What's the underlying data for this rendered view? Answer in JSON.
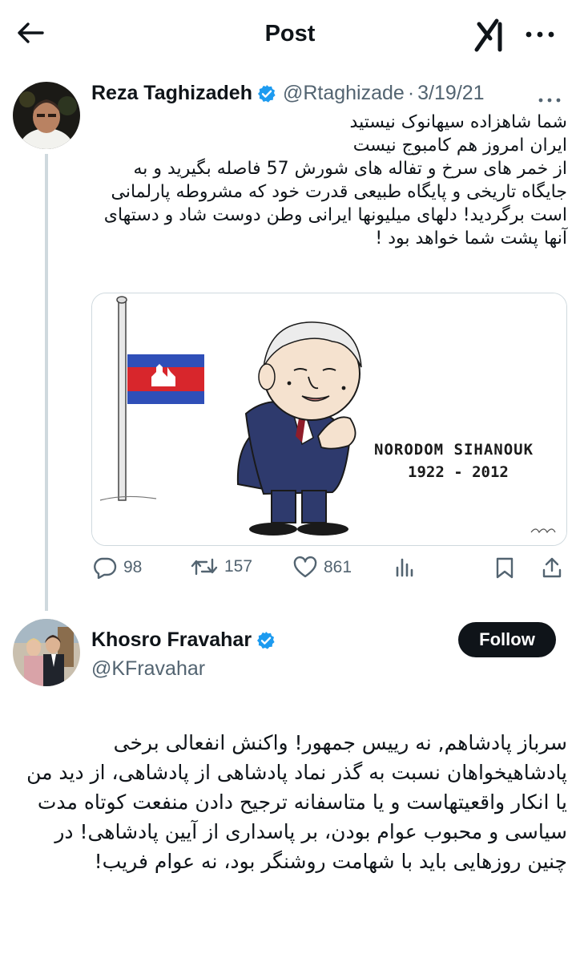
{
  "header": {
    "title": "Post",
    "back_icon": "arrow-left-icon",
    "grok_icon": "grok-icon",
    "more_icon": "more-horizontal-icon"
  },
  "tweet1": {
    "name": "Reza Taghizadeh",
    "handle": "@Rtaghizade",
    "separator": "·",
    "date": "3/19/21",
    "text": "شما شاهزاده سیهانوک نیستید\nایران امروز هم کامبوج نیست\nاز خمر های سرخ و تفاله های شورش 57 فاصله بگیرید و به جایگاه تاریخی و پایگاه طبیعی قدرت خود  که مشروطه پارلمانی است برگردید! دلهای میلیونها ایرانی وطن دوست شاد و دستهای آنها پشت شما خواهد بود !",
    "media": {
      "caption_name": "NORODOM SIHANOUK",
      "caption_years": "1922 - 2012"
    },
    "stats": {
      "replies": "98",
      "reposts": "157",
      "likes": "861"
    }
  },
  "tweet2": {
    "name": "Khosro Fravahar",
    "handle": "@KFravahar",
    "follow_label": "Follow",
    "text": "سرباز پادشاهم, نه رییس جمهور! واکنش انفعالی برخی پادشاهیخواهان نسبت به گذر نماد پادشاهی از پادشاهی، از دید من یا انکار واقعیتهاست و یا متاسفانه ترجیح دادن منفعت کوتاه مدت سیاسی و محبوب عوام بودن، بر پاسداری از آیین پادشاهی! در چنین روزهایی باید  با شهامت روشنگر بود، نه عوام فریب!"
  },
  "colors": {
    "text": "#0f1419",
    "secondary": "#536471",
    "verified": "#1d9bf0",
    "divider": "#cfd9de"
  }
}
